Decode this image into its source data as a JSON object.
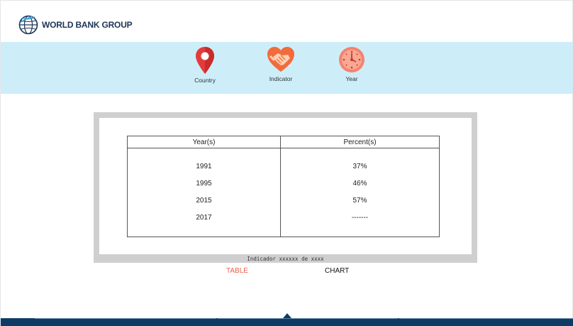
{
  "brand": {
    "name": "WORLD BANK GROUP",
    "logo_icon": "globe-icon"
  },
  "selectors": {
    "country": {
      "label": "Country",
      "icon": "location-pin-icon",
      "color": "#e23b3b"
    },
    "indicator": {
      "label": "Indicator",
      "icon": "handshake-heart-icon",
      "color": "#f26b3a"
    },
    "year": {
      "label": "Year",
      "icon": "clock-icon",
      "color": "#f5836e"
    }
  },
  "table": {
    "headers": [
      "Year(s)",
      "Percent(s)"
    ],
    "rows": [
      {
        "year": "1991",
        "percent": "37%"
      },
      {
        "year": "1995",
        "percent": "46%"
      },
      {
        "year": "2015",
        "percent": "57%"
      },
      {
        "year": "2017",
        "percent": "-------"
      }
    ],
    "caption": "Indicador xxxxxx de xxxx"
  },
  "views": {
    "table_label": "TABLE",
    "chart_label": "CHART",
    "active": "TABLE"
  },
  "colors": {
    "band": "#cdeef9",
    "footer": "#0d3b66",
    "accent": "#e8604c"
  }
}
